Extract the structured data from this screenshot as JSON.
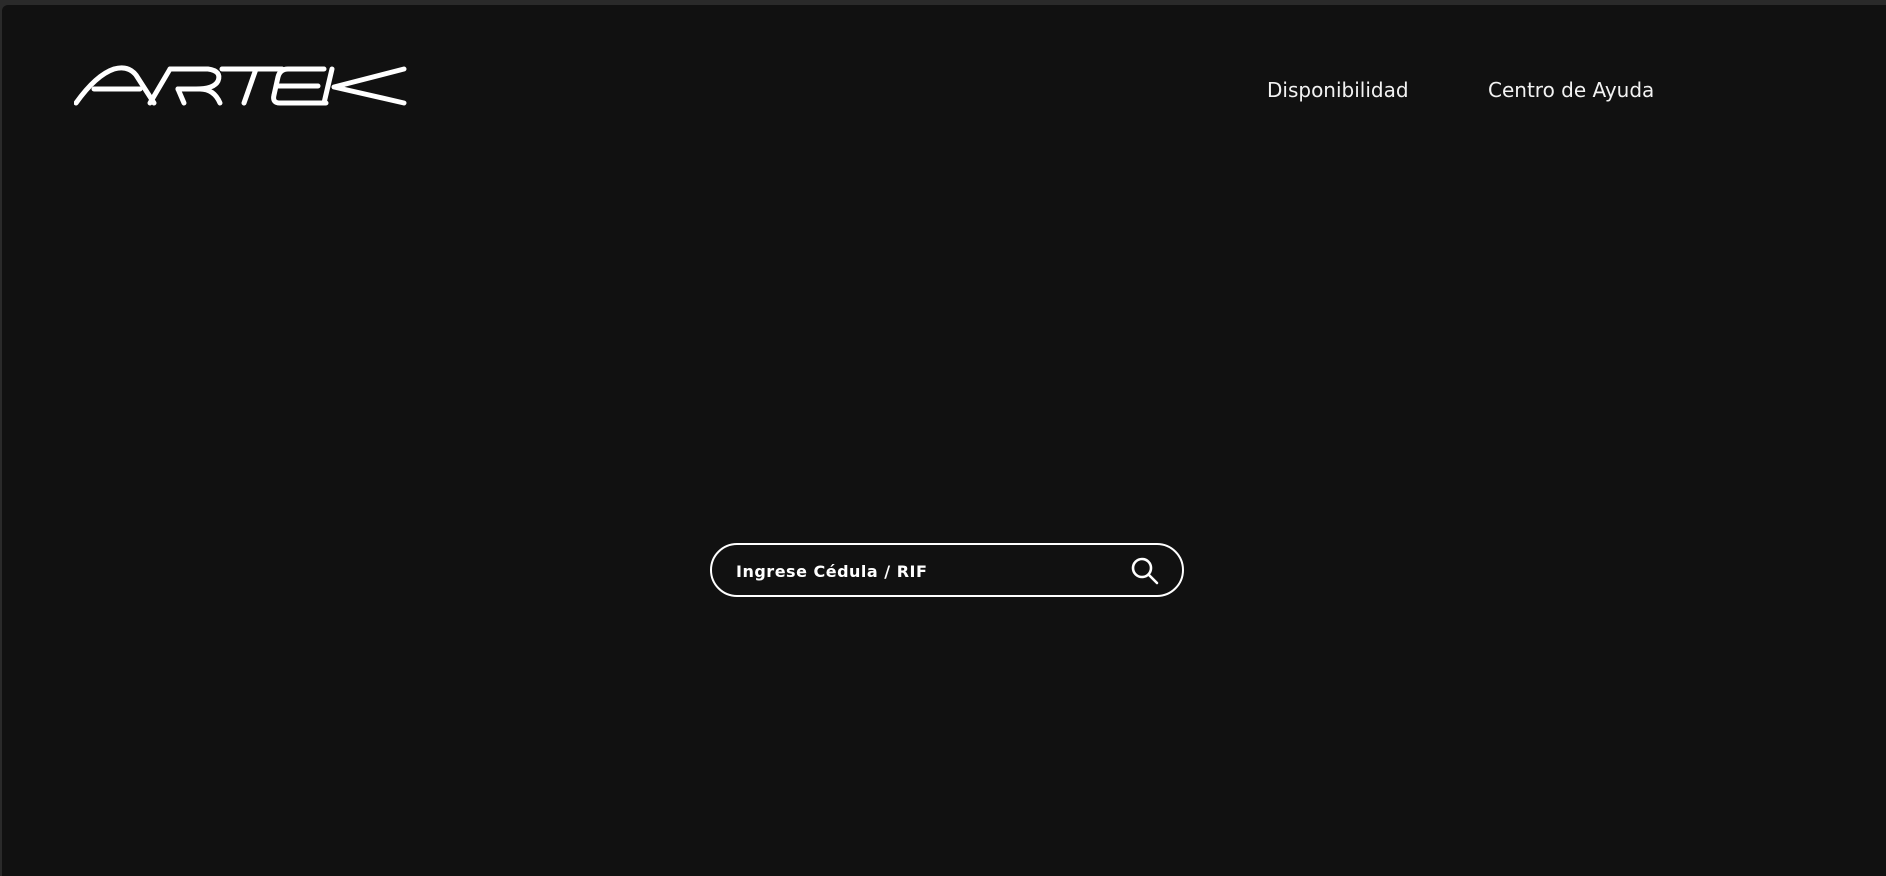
{
  "header": {
    "logo_text": "AIRTEK",
    "logo_icon": "airtek-logo",
    "nav": [
      {
        "label": "Disponibilidad"
      },
      {
        "label": "Centro de Ayuda"
      }
    ]
  },
  "search": {
    "placeholder": "Ingrese Cédula / RIF",
    "value": "",
    "icon": "search-icon"
  },
  "colors": {
    "background": "#111111",
    "foreground": "#ffffff"
  }
}
